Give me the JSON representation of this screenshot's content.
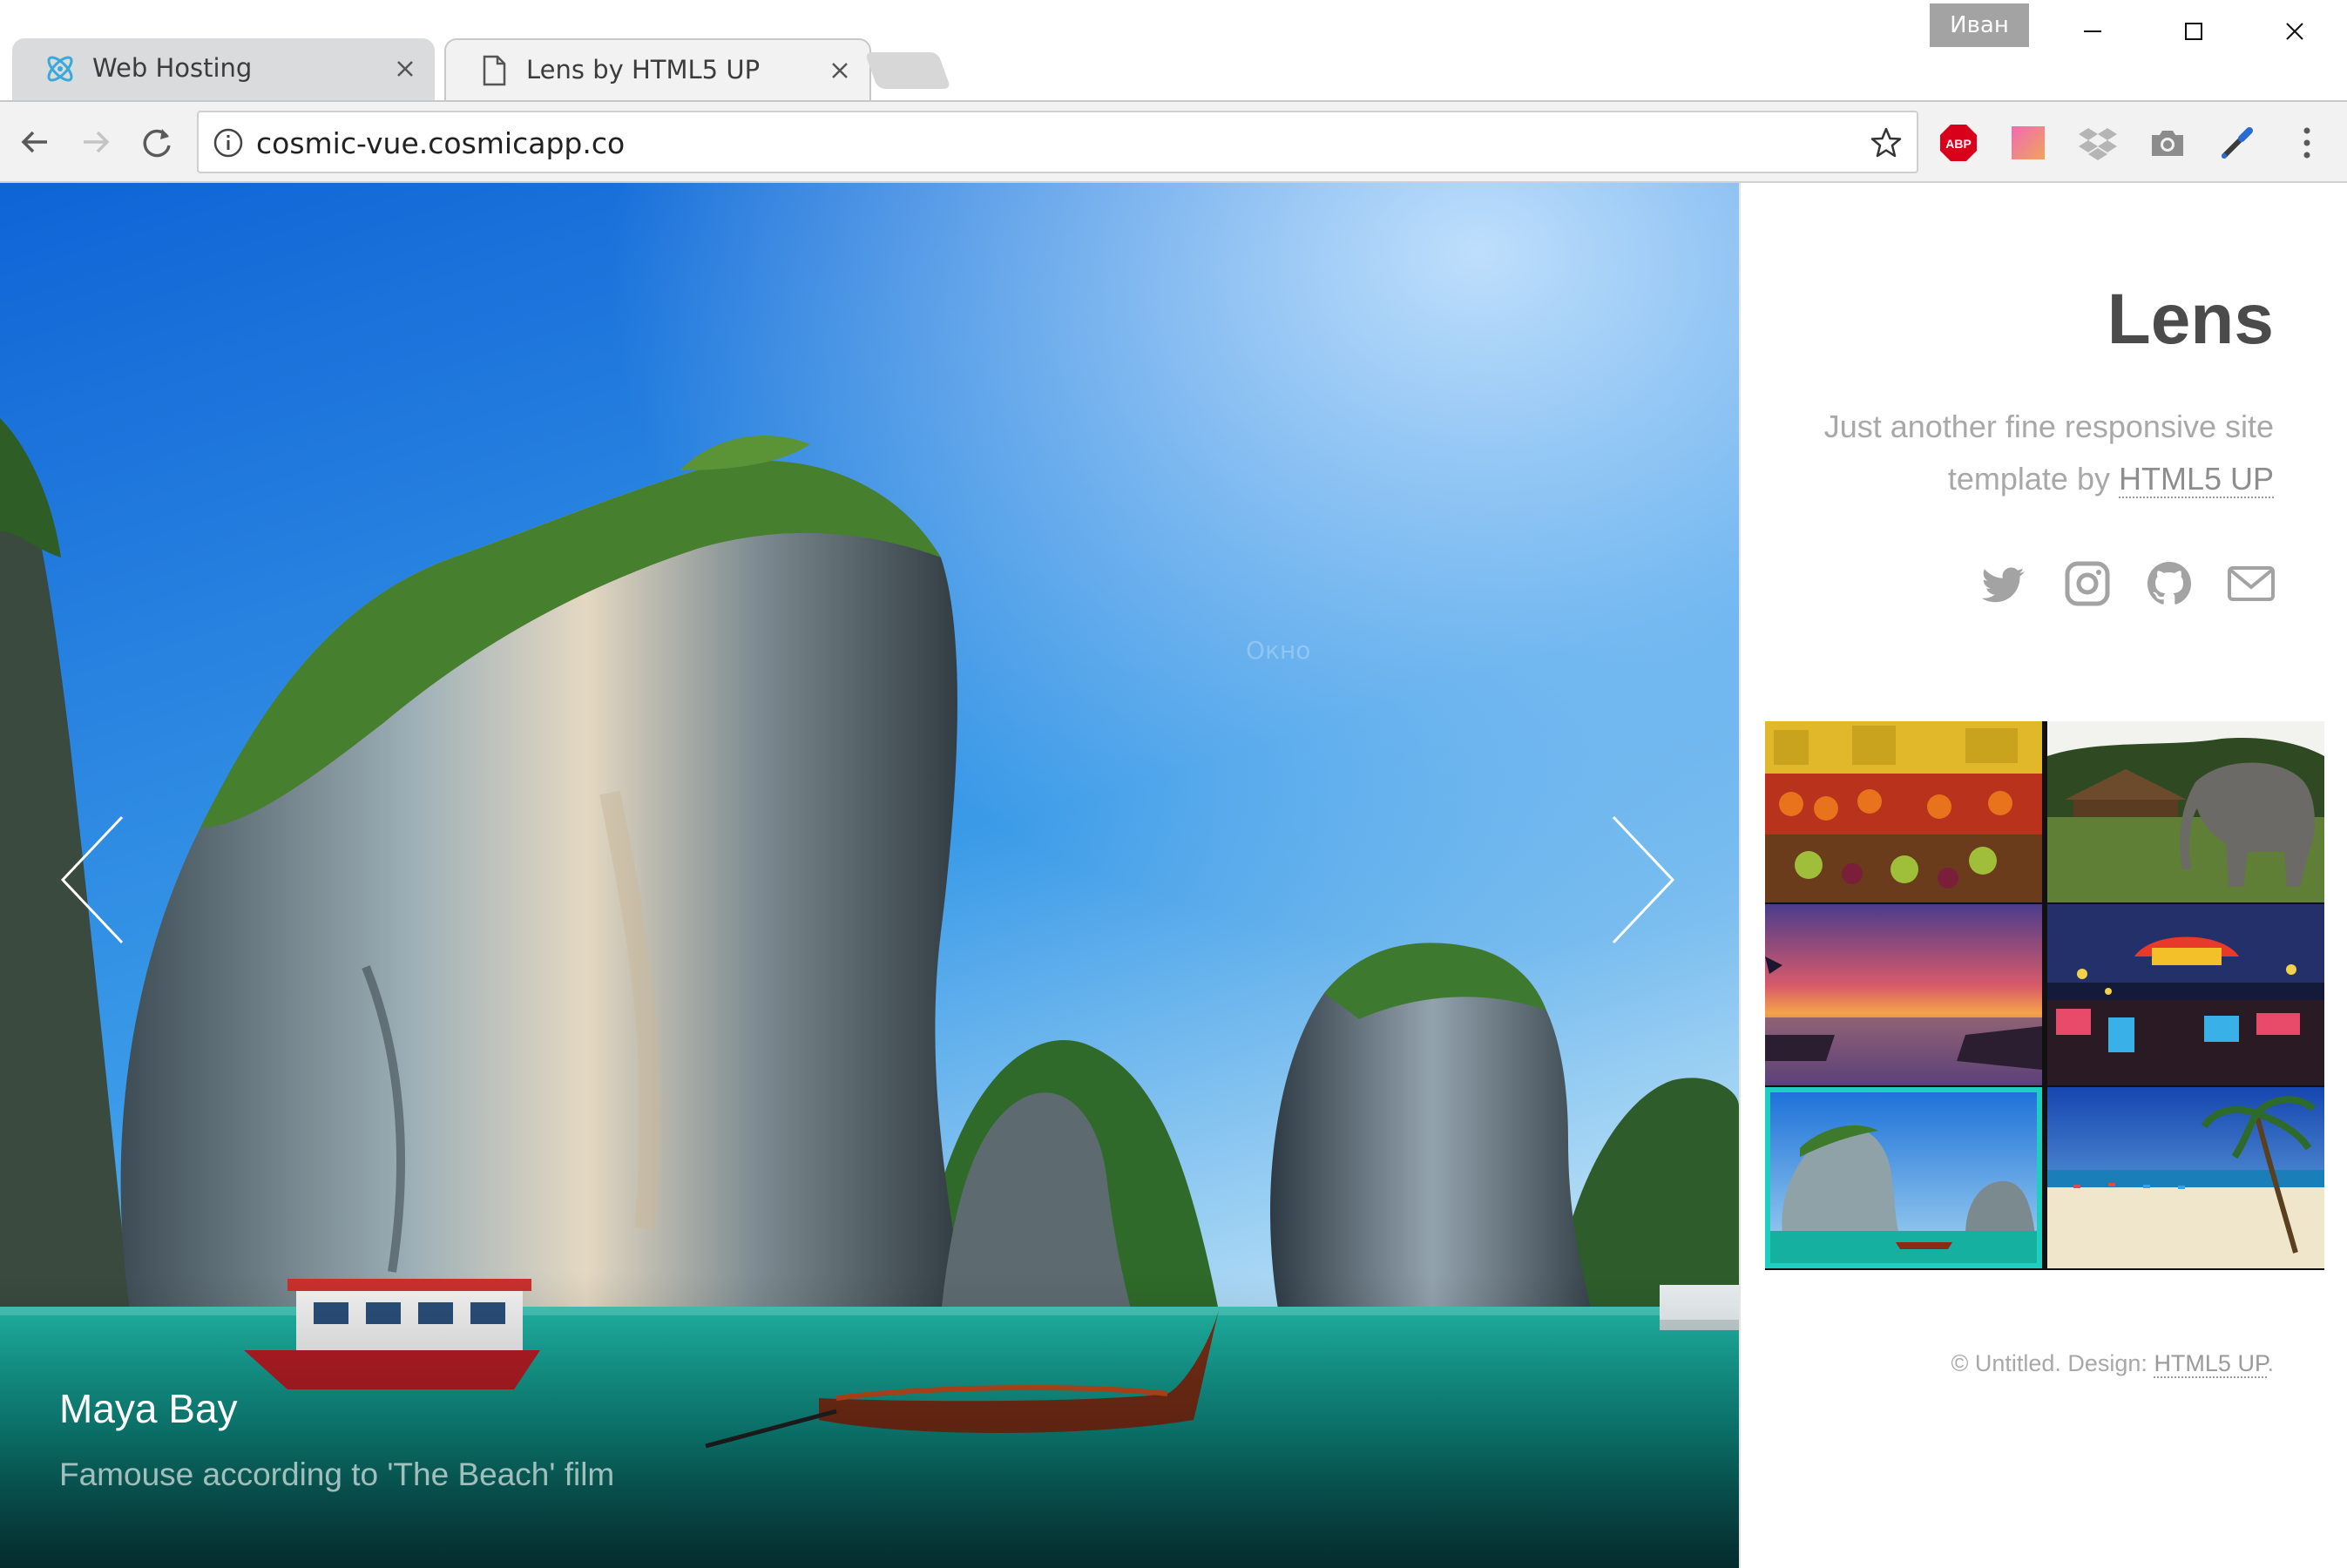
{
  "browser": {
    "tabs": [
      {
        "title": "Web Hosting",
        "icon": "cosmic-logo-icon"
      },
      {
        "title": "Lens by HTML5 UP",
        "icon": "document-icon",
        "active": true
      }
    ],
    "user_badge": "Иван",
    "url": "cosmic-vue.cosmicapp.co",
    "extensions": [
      {
        "name": "adblock-plus-icon",
        "label": "ABP"
      },
      {
        "name": "gradient-extension-icon"
      },
      {
        "name": "dropbox-icon"
      },
      {
        "name": "camera-icon"
      },
      {
        "name": "color-picker-icon"
      }
    ]
  },
  "viewer": {
    "caption_title": "Maya Bay",
    "caption_text": "Famouse according to 'The Beach' film",
    "watermark": "Окно"
  },
  "sidebar": {
    "title": "Lens",
    "description_prefix": "Just another fine responsive site template by ",
    "description_link": "HTML5 UP",
    "social": [
      "twitter-icon",
      "instagram-icon",
      "github-icon",
      "email-icon"
    ],
    "thumbnails": [
      {
        "name": "fruit-market-thumbnail",
        "active": false
      },
      {
        "name": "elephant-thumbnail",
        "active": false
      },
      {
        "name": "sunset-pier-thumbnail",
        "active": false
      },
      {
        "name": "night-market-thumbnail",
        "active": false
      },
      {
        "name": "maya-bay-thumbnail",
        "active": true
      },
      {
        "name": "beach-palm-thumbnail",
        "active": false
      }
    ],
    "footer_prefix": "© Untitled.  Design: ",
    "footer_link": "HTML5 UP",
    "footer_suffix": "."
  },
  "colors": {
    "accent": "#1ccfbf",
    "title": "#4b4b4b",
    "muted_text": "#a8a8a8"
  }
}
